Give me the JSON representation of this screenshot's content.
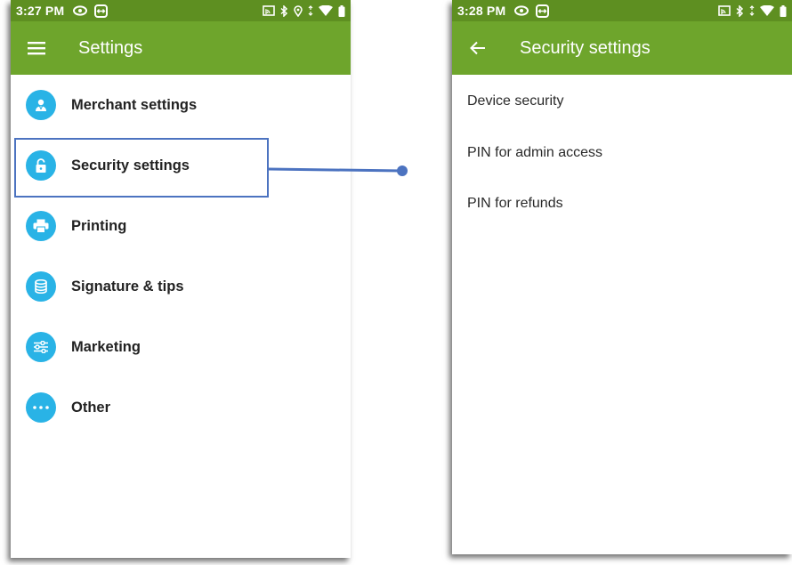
{
  "left_screen": {
    "status": {
      "time": "3:27 PM"
    },
    "appbar": {
      "title": "Settings",
      "menu_icon": "hamburger-menu-icon"
    },
    "menu_items": [
      {
        "label": "Merchant settings",
        "icon": "merchant-person-icon"
      },
      {
        "label": "Security settings",
        "icon": "unlock-icon",
        "highlighted": true
      },
      {
        "label": "Printing",
        "icon": "printer-icon"
      },
      {
        "label": "Signature & tips",
        "icon": "coins-icon"
      },
      {
        "label": "Marketing",
        "icon": "sliders-icon"
      },
      {
        "label": "Other",
        "icon": "more-dots-icon"
      }
    ]
  },
  "right_screen": {
    "status": {
      "time": "3:28 PM"
    },
    "appbar": {
      "title": "Security settings",
      "back_icon": "back-arrow-icon"
    },
    "items": [
      {
        "label": "Device security"
      },
      {
        "label": "PIN for admin access"
      },
      {
        "label": "PIN for refunds"
      }
    ]
  },
  "colors": {
    "statusbar": "#5e8f21",
    "appbar": "#6ea52c",
    "icon_circle": "#29b3e6",
    "highlight": "#4c73c0"
  }
}
